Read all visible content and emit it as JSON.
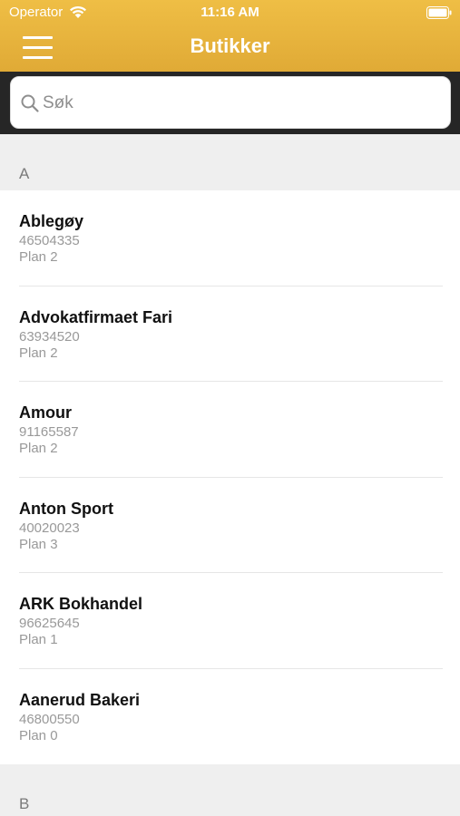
{
  "status_bar": {
    "carrier": "Operator",
    "time": "11:16 AM"
  },
  "nav": {
    "title": "Butikker"
  },
  "search": {
    "placeholder": "Søk",
    "value": ""
  },
  "sections": [
    {
      "letter": "A",
      "items": [
        {
          "name": "Ablegøy",
          "phone": "46504335",
          "plan": "Plan 2"
        },
        {
          "name": "Advokatfirmaet Fari",
          "phone": "63934520",
          "plan": "Plan 2"
        },
        {
          "name": "Amour",
          "phone": "91165587",
          "plan": "Plan 2"
        },
        {
          "name": "Anton Sport",
          "phone": "40020023",
          "plan": "Plan 3"
        },
        {
          "name": "ARK Bokhandel",
          "phone": "96625645",
          "plan": "Plan 1"
        },
        {
          "name": "Aanerud Bakeri",
          "phone": "46800550",
          "plan": "Plan 0"
        }
      ]
    },
    {
      "letter": "B",
      "items": []
    }
  ],
  "colors": {
    "header": "#e6b23c",
    "search_bar_bg": "#262626",
    "section_bg": "#efefef"
  },
  "icons": [
    "wifi-icon",
    "battery-icon",
    "menu-icon",
    "search-icon"
  ]
}
